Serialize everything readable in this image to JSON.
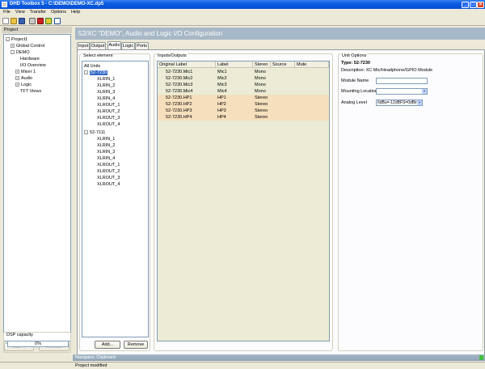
{
  "window": {
    "title": "DHD Toolbox 5 - C:\\DEMO\\DEMO-XC.dp5"
  },
  "menu": [
    "File",
    "View",
    "Transfer",
    "Options",
    "Help"
  ],
  "project": {
    "header": "Project",
    "tree": [
      {
        "label": "Project1",
        "exp": "-"
      },
      {
        "label": "Global Control",
        "exp": "+"
      },
      {
        "label": "DEMO",
        "exp": "-"
      },
      {
        "label": "Hardware",
        "exp": ""
      },
      {
        "label": "I/O Overview",
        "exp": ""
      },
      {
        "label": "Mixer 1",
        "exp": "+"
      },
      {
        "label": "Audio",
        "exp": "+"
      },
      {
        "label": "Logic",
        "exp": "+"
      },
      {
        "label": "TFT Views",
        "exp": ""
      }
    ],
    "add_label": "Add ...",
    "remove_label": "Remove",
    "dsp": {
      "title": "DSP capacity",
      "value": "0%",
      "percent": 0
    }
  },
  "main": {
    "banner": "52/XC \"DEMO\", Audio and Logic I/O  Configuration",
    "tabs": [
      "Input",
      "Output",
      "Audio",
      "Logic",
      "Ports"
    ],
    "active_tab": "Audio"
  },
  "select_element": {
    "title": "Select element",
    "items": [
      {
        "label": "All Units",
        "level": 0
      },
      {
        "label": "52-7230",
        "level": 1,
        "exp": "-",
        "selected": true
      },
      {
        "label": "XLRIN_1",
        "level": 2
      },
      {
        "label": "XLRIN_2",
        "level": 2
      },
      {
        "label": "XLRIN_3",
        "level": 2
      },
      {
        "label": "XLRIN_4",
        "level": 2
      },
      {
        "label": "XLROUT_1",
        "level": 2
      },
      {
        "label": "XLROUT_2",
        "level": 2
      },
      {
        "label": "XLROUT_3",
        "level": 2
      },
      {
        "label": "XLROUT_4",
        "level": 2
      },
      {
        "label": "52-7111",
        "level": 1,
        "exp": "-"
      },
      {
        "label": "XLRIN_1",
        "level": 2
      },
      {
        "label": "XLRIN_2",
        "level": 2
      },
      {
        "label": "XLRIN_3",
        "level": 2
      },
      {
        "label": "XLRIN_4",
        "level": 2
      },
      {
        "label": "XLROUT_1",
        "level": 2
      },
      {
        "label": "XLROUT_2",
        "level": 2
      },
      {
        "label": "XLROUT_3",
        "level": 2
      },
      {
        "label": "XLROUT_4",
        "level": 2
      }
    ],
    "add_label": "Add...",
    "remove_label": "Remove"
  },
  "io": {
    "title": "Inputs/Outputs",
    "columns": [
      "Original Label",
      "Label",
      "Stereo",
      "Source",
      "Mute"
    ],
    "rows": [
      {
        "original": "52-7230.Mic1",
        "label": "Mic1",
        "stereo": "Mono",
        "hl": false
      },
      {
        "original": "52-7230.Mic2",
        "label": "Mic2",
        "stereo": "Mono",
        "hl": false
      },
      {
        "original": "52-7230.Mic3",
        "label": "Mic3",
        "stereo": "Mono",
        "hl": false
      },
      {
        "original": "52-7230.Mic4",
        "label": "Mic4",
        "stereo": "Mono",
        "hl": false
      },
      {
        "original": "52-7230.HP1",
        "label": "HP1",
        "stereo": "Stereo",
        "hl": true
      },
      {
        "original": "52-7230.HP2",
        "label": "HP2",
        "stereo": "Stereo",
        "hl": true
      },
      {
        "original": "52-7230.HP3",
        "label": "HP3",
        "stereo": "Stereo",
        "hl": true
      },
      {
        "original": "52-7230.HP4",
        "label": "HP4",
        "stereo": "Stereo",
        "hl": true
      }
    ]
  },
  "unit_options": {
    "title": "Unit Options",
    "type": "Type: 52-7230",
    "description": "Description: XC Mic/Headphone/GPIO Module",
    "module_name_label": "Module Name",
    "module_name_value": "",
    "mounting_label": "Mounting Location",
    "mounting_value": "",
    "analog_label": "Analog Level",
    "analog_value": "6dBu=-12dBFS=0dBint"
  },
  "navigator": "Navigator, Clipboard",
  "status": "Project modified",
  "colors": {
    "banner": "#a7b8c7",
    "selection": "#316ac5",
    "highlight_row": "#f6dfbd"
  }
}
